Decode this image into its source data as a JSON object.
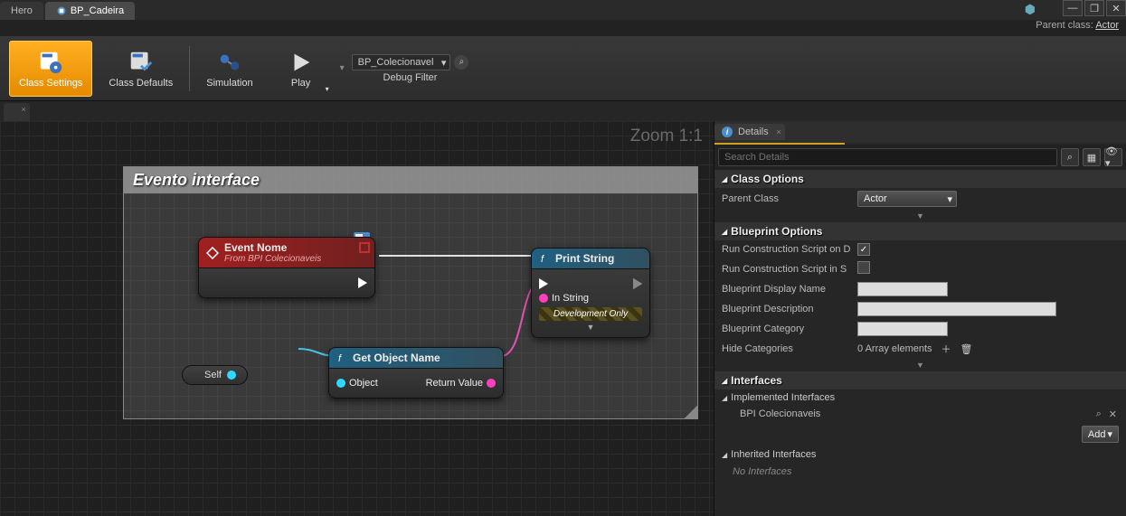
{
  "tabs": {
    "hero": "Hero",
    "cadeira": "BP_Cadeira"
  },
  "parent_class_label": "Parent class:",
  "parent_class_link": "Actor",
  "toolbar": {
    "class_settings": "Class Settings",
    "class_defaults": "Class Defaults",
    "simulation": "Simulation",
    "play": "Play",
    "debug_combo": "BP_Colecionavel",
    "debug_filter_label": "Debug Filter"
  },
  "zoom": "Zoom 1:1",
  "comment_title": "Evento interface",
  "nodes": {
    "event": {
      "title": "Event Nome",
      "subtitle": "From BPI Colecionaveis"
    },
    "print": {
      "title": "Print String",
      "in_string": "In String",
      "dev_only": "Development Only"
    },
    "getname": {
      "title": "Get Object Name",
      "object": "Object",
      "return": "Return Value"
    },
    "self": "Self"
  },
  "details": {
    "tab": "Details",
    "search_placeholder": "Search Details",
    "sections": {
      "class_options": "Class Options",
      "parent_class": "Parent Class",
      "parent_class_value": "Actor",
      "blueprint_options": "Blueprint Options",
      "run_drag": "Run Construction Script on D",
      "run_seq": "Run Construction Script in S",
      "bp_display": "Blueprint Display Name",
      "bp_desc": "Blueprint Description",
      "bp_cat": "Blueprint Category",
      "hide_cat": "Hide Categories",
      "hide_cat_value": "0 Array elements",
      "interfaces": "Interfaces",
      "impl_interfaces": "Implemented Interfaces",
      "bpi_name": "BPI Colecionaveis",
      "add_btn": "Add",
      "inherited": "Inherited Interfaces",
      "no_interfaces": "No Interfaces"
    }
  }
}
